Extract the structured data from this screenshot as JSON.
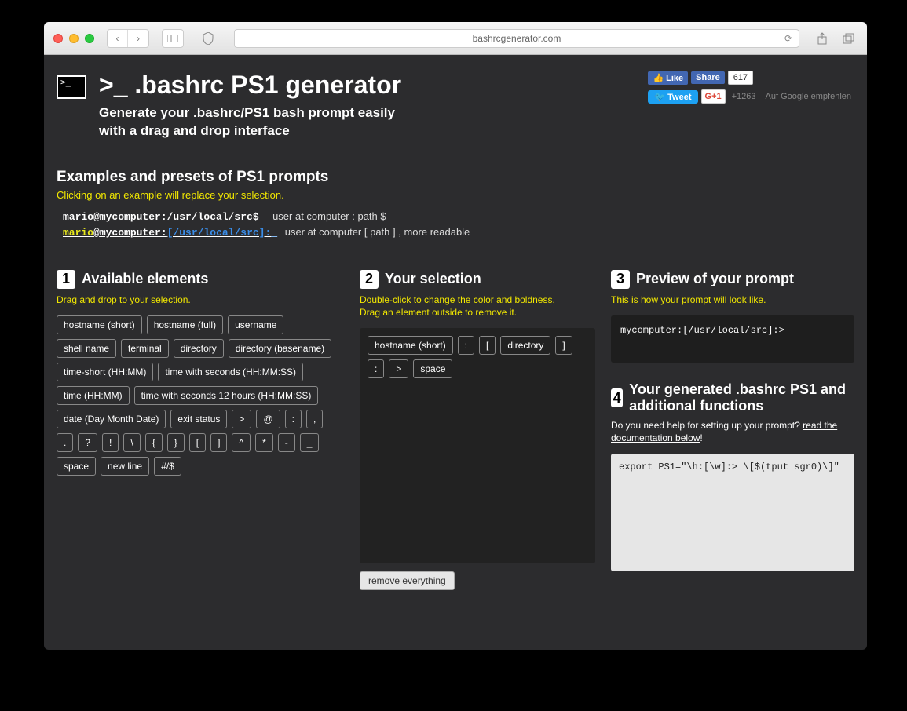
{
  "chrome": {
    "url": "bashrcgenerator.com"
  },
  "header": {
    "title": ">_ .bashrc PS1 generator",
    "subtitle_l1": "Generate your .bashrc/PS1 bash prompt easily",
    "subtitle_l2": "with a drag and drop interface"
  },
  "social": {
    "fb_like": "Like",
    "fb_share": "Share",
    "fb_count": "617",
    "tweet": "Tweet",
    "gplus": "G+1",
    "gcount": "+1263",
    "grecommend": "Auf Google empfehlen"
  },
  "examples": {
    "heading": "Examples and presets of PS1 prompts",
    "hint": "Clicking on an example will replace your selection.",
    "ex1_prompt": "mario@mycomputer:/usr/local/src$_",
    "ex1_desc": "user at computer : path $",
    "ex2_user": "mario",
    "ex2_at": "@",
    "ex2_host": "mycomputer:",
    "ex2_path": "[/usr/local/src]:_",
    "ex2_desc": "user at computer [ path ] , more readable"
  },
  "col1": {
    "num": "1",
    "title": "Available elements",
    "hint": "Drag and drop to your selection.",
    "chips": [
      "hostname (short)",
      "hostname (full)",
      "username",
      "shell name",
      "terminal",
      "directory",
      "directory (basename)",
      "time-short (HH:MM)",
      "time with seconds (HH:MM:SS)",
      "time (HH:MM)",
      "time with seconds 12 hours (HH:MM:SS)",
      "date (Day Month Date)",
      "exit status",
      ">",
      "@",
      ":",
      ",",
      ".",
      "?",
      "!",
      "\\",
      "{",
      "}",
      "[",
      "]",
      "^",
      "*",
      "-",
      "_",
      "space",
      "new line",
      "#/$"
    ]
  },
  "col2": {
    "num": "2",
    "title": "Your selection",
    "hint": "Double-click to change the color and boldness.\nDrag an element outside to remove it.",
    "chips": [
      "hostname (short)",
      ":",
      "[",
      "directory",
      "]",
      ":",
      ">",
      "space"
    ],
    "remove": "remove everything"
  },
  "col3": {
    "num": "3",
    "title": "Preview of your prompt",
    "hint": "This is how your prompt will look like.",
    "preview": "mycomputer:[/usr/local/src]:>"
  },
  "col4": {
    "num": "4",
    "title": "Your generated .bashrc PS1 and additional functions",
    "hint_pre": "Do you need help for setting up your prompt? ",
    "hint_link": "read the documentation below",
    "code": "export PS1=\"\\h:[\\w]:> \\[$(tput sgr0)\\]\""
  }
}
